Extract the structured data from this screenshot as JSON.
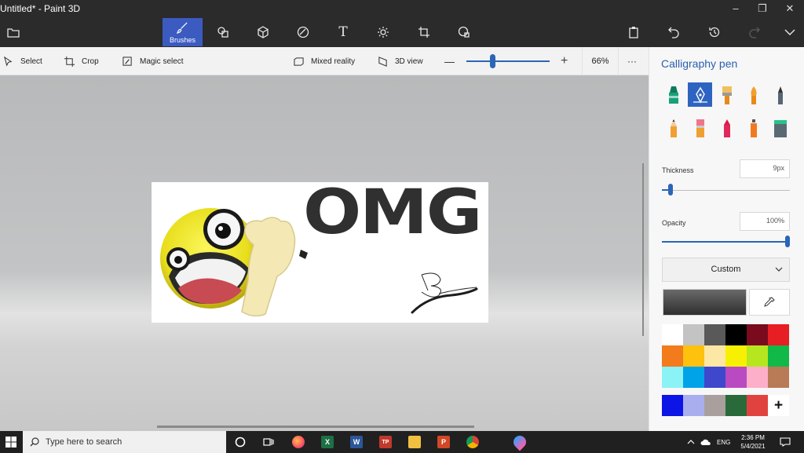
{
  "window": {
    "title": "Untitled* - Paint 3D",
    "minimize": "–",
    "maximize": "❐",
    "close": "✕"
  },
  "ribbon": {
    "active_tab_label": "Brushes",
    "tabs": [
      "menu-icon",
      "brushes-icon",
      "2d-shapes-icon",
      "3d-shapes-icon",
      "stickers-icon",
      "text-icon",
      "effects-icon",
      "canvas-icon",
      "3d-library-icon"
    ],
    "actions": [
      "paste-icon",
      "undo-icon",
      "history-icon",
      "redo-icon",
      "expand-icon"
    ]
  },
  "toolbar": {
    "select_label": "Select",
    "crop_label": "Crop",
    "magic_select_label": "Magic select",
    "mixed_reality_label": "Mixed reality",
    "view_3d_label": "3D view",
    "zoom_minus": "—",
    "zoom_plus": "+",
    "zoom_level": "66%",
    "zoom_fraction": 0.3,
    "more": "···"
  },
  "canvas": {
    "sticker_text": "OMG",
    "signature": "B"
  },
  "panel": {
    "title": "Calligraphy pen",
    "brushes": [
      "marker",
      "calligraphy-pen",
      "oil-brush",
      "watercolor",
      "pixel-pen",
      "pencil",
      "eraser",
      "crayon",
      "spray-can",
      "fill"
    ],
    "selected_brush": "calligraphy-pen",
    "thickness_label": "Thickness",
    "thickness_value": "9px",
    "thickness_fraction": 0.05,
    "opacity_label": "Opacity",
    "opacity_value": "100%",
    "opacity_fraction": 1.0,
    "finish_label": "Custom",
    "current_color": "#3c3c3c",
    "palette": [
      "#ffffff",
      "#c3c3c3",
      "#595959",
      "#000000",
      "#7a0a1e",
      "#e81e25",
      "#f27b1c",
      "#fdc10e",
      "#fde7a4",
      "#f8f002",
      "#b6e61d",
      "#11b948",
      "#8bf2f6",
      "#00a3e8",
      "#3f47cc",
      "#b94ac1",
      "#fdaec9",
      "#b97a56"
    ],
    "custom_colors": [
      "#0c14e6",
      "#a8aeee",
      "#a9a09d",
      "#2a6a3a",
      "#e2423f"
    ],
    "add_color_label": "+"
  },
  "taskbar": {
    "search_placeholder": "Type here to search",
    "apps": [
      "cortana-icon",
      "task-view-icon",
      "firefox-icon",
      "excel-icon",
      "word-icon",
      "app-icon",
      "file-explorer-icon",
      "powerpoint-icon",
      "chrome-icon",
      "paint3d-icon"
    ],
    "language": "ENG",
    "time": "2:36 PM",
    "date": "5/4/2021"
  }
}
